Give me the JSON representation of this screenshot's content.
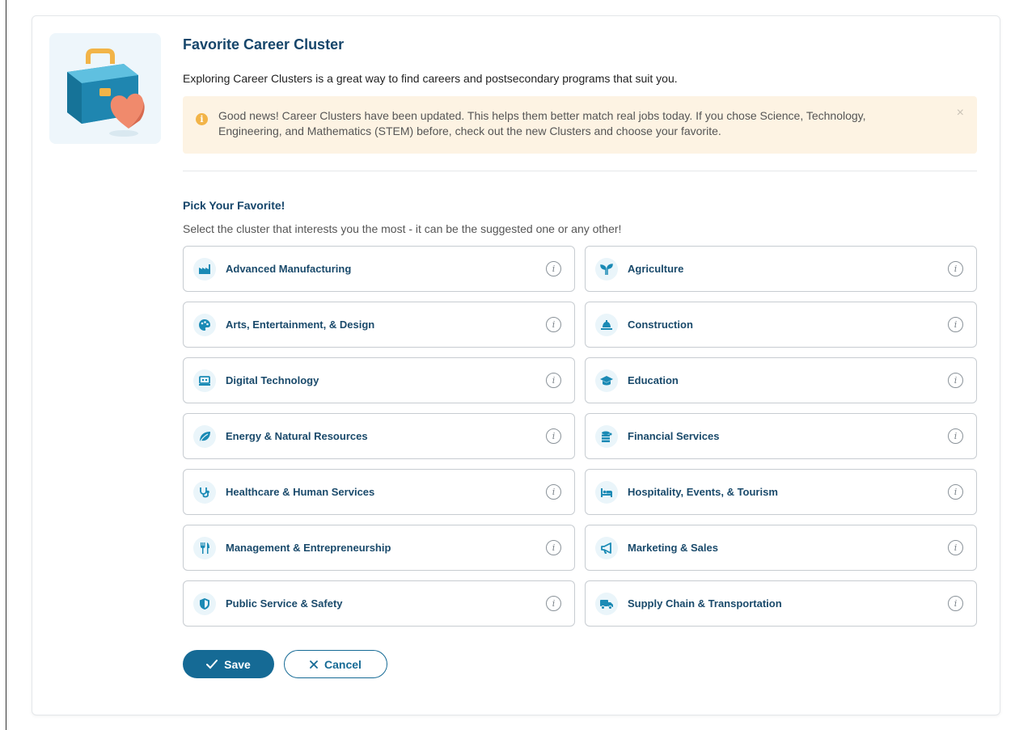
{
  "header": {
    "title": "Favorite Career Cluster",
    "intro": "Exploring Career Clusters is a great way to find careers and postsecondary programs that suit you."
  },
  "alert": {
    "icon": "info-icon",
    "text": "Good news! Career Clusters have been updated. This helps them better match real jobs today. If you chose Science, Technology, Engineering, and Mathematics (STEM) before, check out the new Clusters and choose your favorite.",
    "close": "×"
  },
  "picker": {
    "title": "Pick Your Favorite!",
    "subtitle": "Select the cluster that interests you the most - it can be the suggested one or any other!",
    "info_glyph": "i",
    "clusters": [
      {
        "label": "Advanced Manufacturing",
        "icon": "factory-icon"
      },
      {
        "label": "Agriculture",
        "icon": "sprout-icon"
      },
      {
        "label": "Arts, Entertainment, & Design",
        "icon": "palette-icon"
      },
      {
        "label": "Construction",
        "icon": "hard-hat-icon"
      },
      {
        "label": "Digital Technology",
        "icon": "laptop-icon"
      },
      {
        "label": "Education",
        "icon": "graduation-cap-icon"
      },
      {
        "label": "Energy & Natural Resources",
        "icon": "leaf-icon"
      },
      {
        "label": "Financial Services",
        "icon": "coins-icon"
      },
      {
        "label": "Healthcare & Human Services",
        "icon": "stethoscope-icon"
      },
      {
        "label": "Hospitality, Events, & Tourism",
        "icon": "bed-icon"
      },
      {
        "label": "Management & Entrepreneurship",
        "icon": "utensils-icon"
      },
      {
        "label": "Marketing & Sales",
        "icon": "megaphone-icon"
      },
      {
        "label": "Public Service & Safety",
        "icon": "shield-icon"
      },
      {
        "label": "Supply Chain & Transportation",
        "icon": "truck-icon"
      }
    ]
  },
  "actions": {
    "save_label": "Save",
    "cancel_label": "Cancel"
  },
  "colors": {
    "primary": "#156a95",
    "heading": "#16466b",
    "alert_bg": "#fdf3e3",
    "alert_icon": "#f2b448",
    "icon_bg": "#eaf5fa"
  }
}
